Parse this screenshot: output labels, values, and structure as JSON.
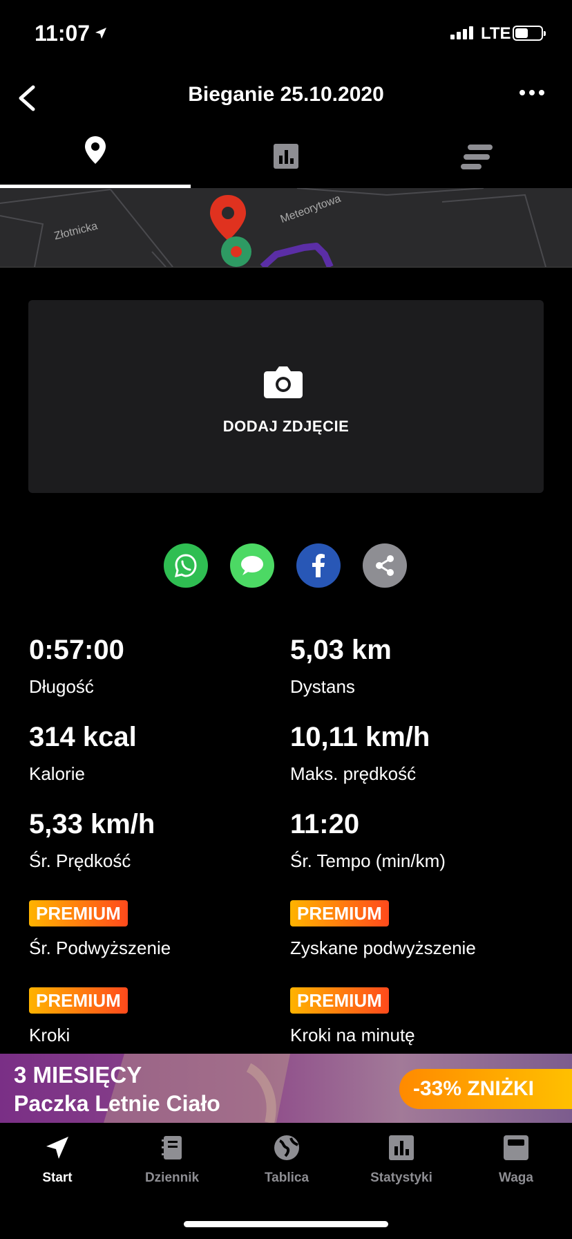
{
  "status_bar": {
    "time": "11:07",
    "network": "LTE"
  },
  "header": {
    "title": "Bieganie 25.10.2020"
  },
  "tabs": [
    {
      "icon": "map-pin-icon",
      "active": true
    },
    {
      "icon": "bar-chart-icon",
      "active": false
    },
    {
      "icon": "laps-icon",
      "active": false
    }
  ],
  "map": {
    "streets": [
      "Złotnicka",
      "Meteorytowa"
    ]
  },
  "photo": {
    "label": "DODAJ ZDJĘCIE"
  },
  "share_icons": [
    "whatsapp-icon",
    "messages-icon",
    "facebook-icon",
    "share-icon"
  ],
  "stats": {
    "duration": {
      "value": "0:57:00",
      "label": "Długość"
    },
    "distance": {
      "value": "5,03 km",
      "label": "Dystans"
    },
    "calories": {
      "value": "314 kcal",
      "label": "Kalorie"
    },
    "max_speed": {
      "value": "10,11 km/h",
      "label": "Maks. prędkość"
    },
    "avg_speed": {
      "value": "5,33 km/h",
      "label": "Śr. Prędkość"
    },
    "avg_pace": {
      "value": "11:20",
      "label": "Śr. Tempo (min/km)"
    },
    "avg_elevation": {
      "badge": "PREMIUM",
      "label": "Śr. Podwyższenie"
    },
    "elevation_gain": {
      "badge": "PREMIUM",
      "label": "Zyskane podwyższenie"
    },
    "steps": {
      "badge": "PREMIUM",
      "label": "Kroki"
    },
    "steps_per_minute": {
      "badge": "PREMIUM",
      "label": "Kroki na minutę"
    }
  },
  "promo": {
    "line1": "3 MIESIĘCY",
    "line2": "Paczka Letnie Ciało",
    "badge": "-33% ZNIŻKI"
  },
  "bottom_nav": [
    {
      "label": "Start",
      "icon": "navigation-arrow-icon",
      "active": true
    },
    {
      "label": "Dziennik",
      "icon": "diary-icon",
      "active": false
    },
    {
      "label": "Tablica",
      "icon": "globe-icon",
      "active": false
    },
    {
      "label": "Statystyki",
      "icon": "bar-chart-icon",
      "active": false
    },
    {
      "label": "Waga",
      "icon": "scale-icon",
      "active": false
    }
  ],
  "colors": {
    "background": "#000000",
    "card": "#1c1c1e",
    "route": "#5b2ea6",
    "premium_from": "#ffb300",
    "premium_to": "#ff4a1c",
    "nav_inactive": "#8e8e93"
  }
}
